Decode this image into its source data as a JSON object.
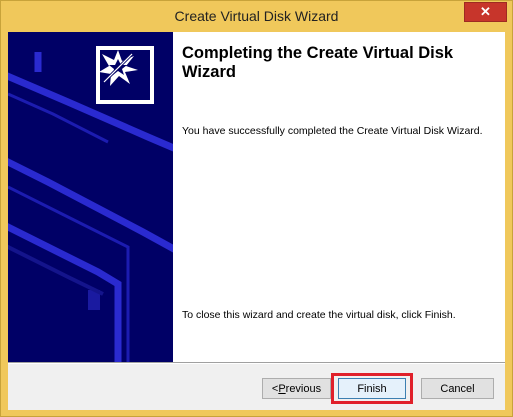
{
  "window": {
    "title": "Create Virtual Disk Wizard",
    "close_glyph": "✕"
  },
  "wizard": {
    "heading": "Completing the Create Virtual Disk Wizard",
    "completion_message": "You have successfully completed the Create Virtual Disk Wizard.",
    "instruction": "To close this wizard and create the virtual disk, click Finish."
  },
  "buttons": {
    "previous_prefix": "<",
    "previous_mnemonic": "P",
    "previous_rest": "revious",
    "finish": "Finish",
    "cancel": "Cancel"
  },
  "icons": {
    "logo": "wizard-burst-icon",
    "close": "close-icon"
  },
  "colors": {
    "titlebar": "#f0c85b",
    "side_panel": "#000066",
    "highlight": "#e0202a",
    "close_button": "#c7352b"
  }
}
